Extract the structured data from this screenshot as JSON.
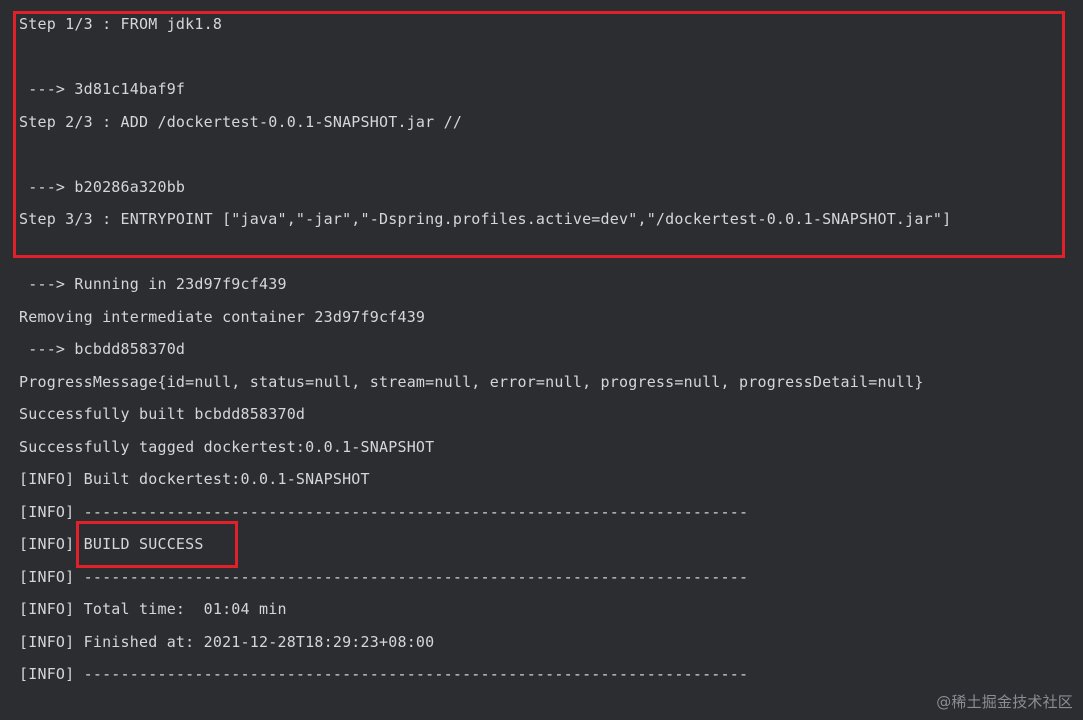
{
  "console": {
    "clipped_top": "─ ─ ─ ─ ─ ─ ─ ─ ─ ─ ─ ─",
    "lines": [
      "Step 1/3 : FROM jdk1.8",
      " ---> 3d81c14baf9f",
      "Step 2/3 : ADD /dockertest-0.0.1-SNAPSHOT.jar //",
      " ---> b20286a320bb",
      "Step 3/3 : ENTRYPOINT [\"java\",\"-jar\",\"-Dspring.profiles.active=dev\",\"/dockertest-0.0.1-SNAPSHOT.jar\"]",
      " ---> Running in 23d97f9cf439",
      "Removing intermediate container 23d97f9cf439",
      " ---> bcbdd858370d",
      "ProgressMessage{id=null, status=null, stream=null, error=null, progress=null, progressDetail=null}",
      "Successfully built bcbdd858370d",
      "Successfully tagged dockertest:0.0.1-SNAPSHOT",
      "[INFO] Built dockertest:0.0.1-SNAPSHOT",
      "[INFO] ------------------------------------------------------------------------",
      "[INFO] BUILD SUCCESS",
      "[INFO] ------------------------------------------------------------------------",
      "[INFO] Total time:  01:04 min",
      "[INFO] Finished at: 2021-12-28T18:29:23+08:00",
      "[INFO] ------------------------------------------------------------------------"
    ]
  },
  "watermark": "@稀土掘金技术社区",
  "colors": {
    "background": "#2b2d30",
    "text": "#d4d6da",
    "highlight": "#e0202a"
  }
}
